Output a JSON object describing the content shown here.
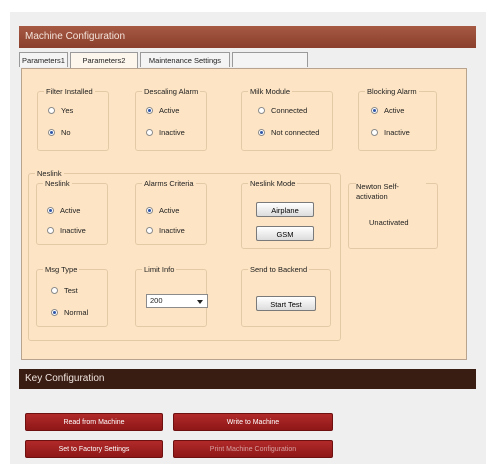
{
  "panel": {
    "title": "Machine Configuration"
  },
  "tabs": [
    {
      "label": "Parameters1"
    },
    {
      "label": "Parameters2"
    },
    {
      "label": "Maintenance Settings"
    }
  ],
  "filter_installed": {
    "title": "Filter Installed",
    "options": [
      "Yes",
      "No"
    ],
    "selected": "No"
  },
  "descaling_alarm": {
    "title": "Descaling Alarm",
    "options": [
      "Active",
      "Inactive"
    ],
    "selected": "Active"
  },
  "milk_module": {
    "title": "Milk Module",
    "options": [
      "Connected",
      "Not connected"
    ],
    "selected": "Not connected"
  },
  "blocking_alarm": {
    "title": "Blocking Alarm",
    "options": [
      "Active",
      "Inactive"
    ],
    "selected": "Active"
  },
  "neslink_section": {
    "title": "Neslink"
  },
  "neslink": {
    "title": "Neslink",
    "options": [
      "Active",
      "Inactive"
    ],
    "selected": "Active"
  },
  "alarms_criteria": {
    "title": "Alarms Criteria",
    "options": [
      "Active",
      "Inactive"
    ],
    "selected": "Active"
  },
  "neslink_mode": {
    "title": "Neslink Mode",
    "buttons": [
      "Airplane",
      "GSM"
    ]
  },
  "newton": {
    "title": "Newton Self-activation",
    "status": "Unactivated"
  },
  "msg_type": {
    "title": "Msg Type",
    "options": [
      "Test",
      "Normal"
    ],
    "selected": "Normal"
  },
  "limit_info": {
    "title": "Limit Info",
    "value": "200"
  },
  "send_backend": {
    "title": "Send to Backend",
    "button": "Start Test"
  },
  "key_config": {
    "title": "Key Configuration"
  },
  "actions": {
    "read": "Read from Machine",
    "write": "Write to Machine",
    "factory": "Set to Factory Settings",
    "print": "Print Machine Configuration"
  }
}
